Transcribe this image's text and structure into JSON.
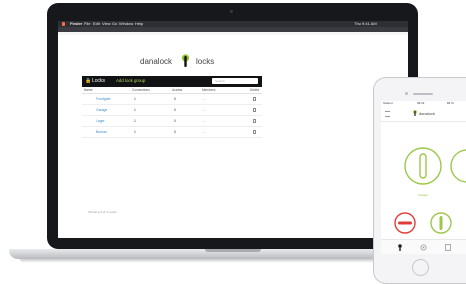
{
  "menubar": {
    "apple_icon": "apple-icon",
    "items": [
      "Finder",
      "File",
      "Edit",
      "View",
      "Go",
      "Window",
      "Help"
    ],
    "clock": "Thu 9:41 AM"
  },
  "logo": {
    "word": "danalock",
    "suffix": "locks"
  },
  "panel": {
    "title": "Locks",
    "add_label": "Add lock group",
    "search_placeholder": "Search"
  },
  "table": {
    "headers": [
      "Name",
      "Connections",
      "Access",
      "Members",
      "Delete"
    ],
    "rows": [
      {
        "name": "Frontgate",
        "connections": "1",
        "access": "0",
        "members": "-"
      },
      {
        "name": "Garage",
        "connections": "1",
        "access": "0",
        "members": "-"
      },
      {
        "name": "Lager",
        "connections": "1",
        "access": "0",
        "members": "-"
      },
      {
        "name": "Bureau",
        "connections": "1",
        "access": "0",
        "members": "-"
      }
    ]
  },
  "footer": {
    "text": "Showing 4 of 4 Locks"
  },
  "phone": {
    "status_left": "Telenor",
    "status_time": "09:41",
    "status_right": "84 %",
    "brand": "danalock",
    "lock_label": "Garage",
    "colors": {
      "green": "#9cc84a",
      "red": "#e23b3b",
      "brand_green": "#8fbf2e"
    }
  }
}
